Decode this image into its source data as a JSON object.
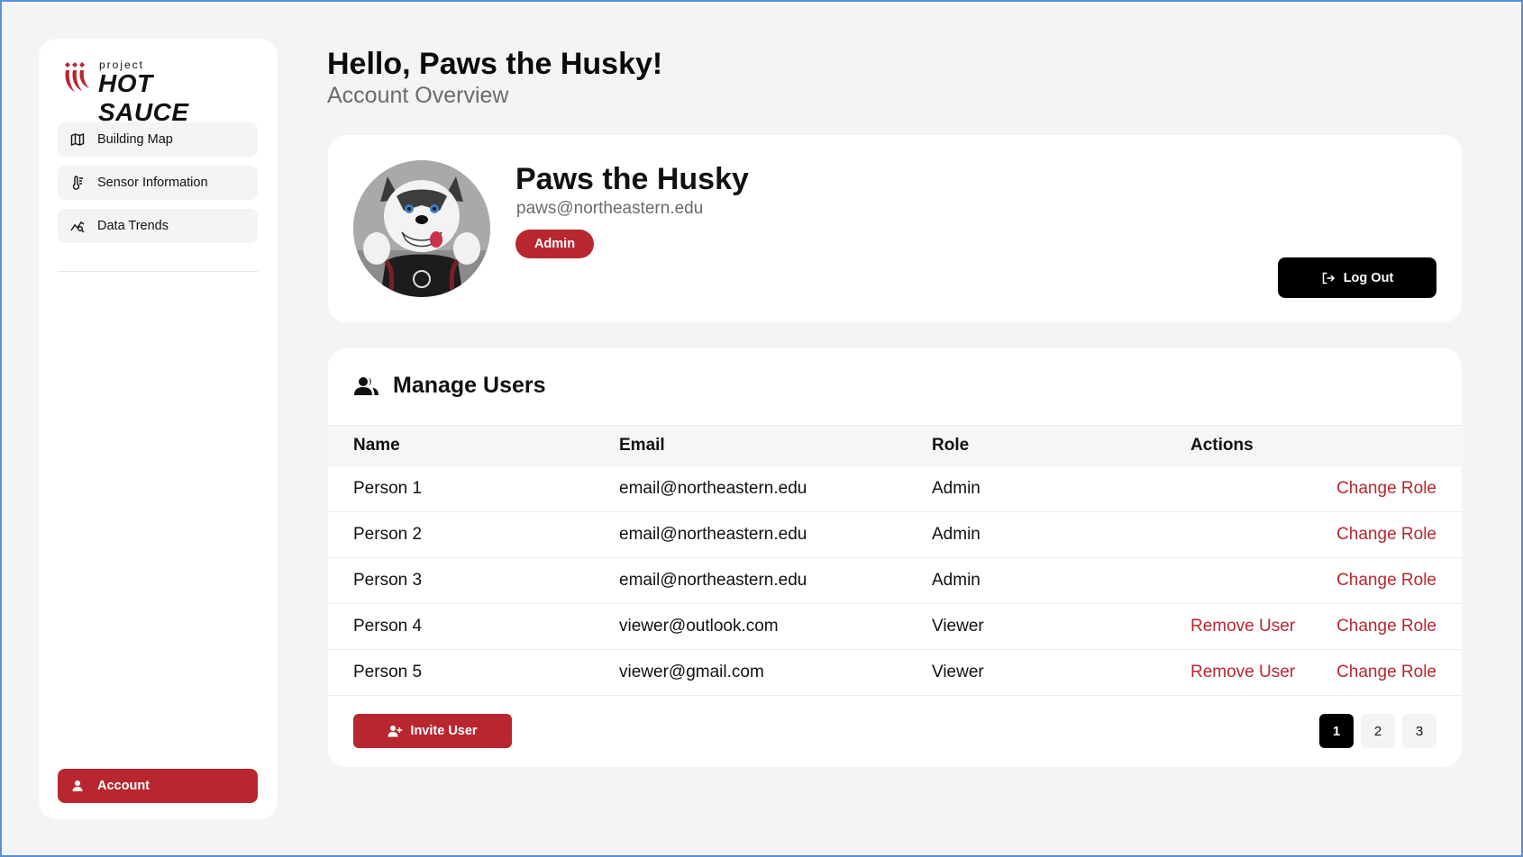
{
  "brand": {
    "small": "project",
    "big": "HOT SAUCE",
    "accent": "#b8262f"
  },
  "sidebar": {
    "items": [
      {
        "label": "Building Map",
        "icon": "map-icon"
      },
      {
        "label": "Sensor Information",
        "icon": "thermometer-icon"
      },
      {
        "label": "Data Trends",
        "icon": "trend-chart-icon"
      }
    ],
    "account": {
      "label": "Account",
      "icon": "user-icon"
    }
  },
  "header": {
    "greeting": "Hello, Paws the Husky!",
    "subtitle": "Account Overview"
  },
  "profile": {
    "name": "Paws the Husky",
    "email": "paws@northeastern.edu",
    "role": "Admin",
    "logout_label": "Log Out"
  },
  "users": {
    "title": "Manage Users",
    "columns": [
      "Name",
      "Email",
      "Role",
      "Actions"
    ],
    "rows": [
      {
        "name": "Person 1",
        "email": "email@northeastern.edu",
        "role": "Admin",
        "remove": "",
        "change": "Change Role"
      },
      {
        "name": "Person 2",
        "email": "email@northeastern.edu",
        "role": "Admin",
        "remove": "",
        "change": "Change Role"
      },
      {
        "name": "Person 3",
        "email": "email@northeastern.edu",
        "role": "Admin",
        "remove": "",
        "change": "Change Role"
      },
      {
        "name": "Person 4",
        "email": "viewer@outlook.com",
        "role": "Viewer",
        "remove": "Remove User",
        "change": "Change Role"
      },
      {
        "name": "Person 5",
        "email": "viewer@gmail.com",
        "role": "Viewer",
        "remove": "Remove User",
        "change": "Change Role"
      }
    ],
    "invite_label": "Invite User",
    "pages": [
      "1",
      "2",
      "3"
    ],
    "current_page": "1"
  }
}
